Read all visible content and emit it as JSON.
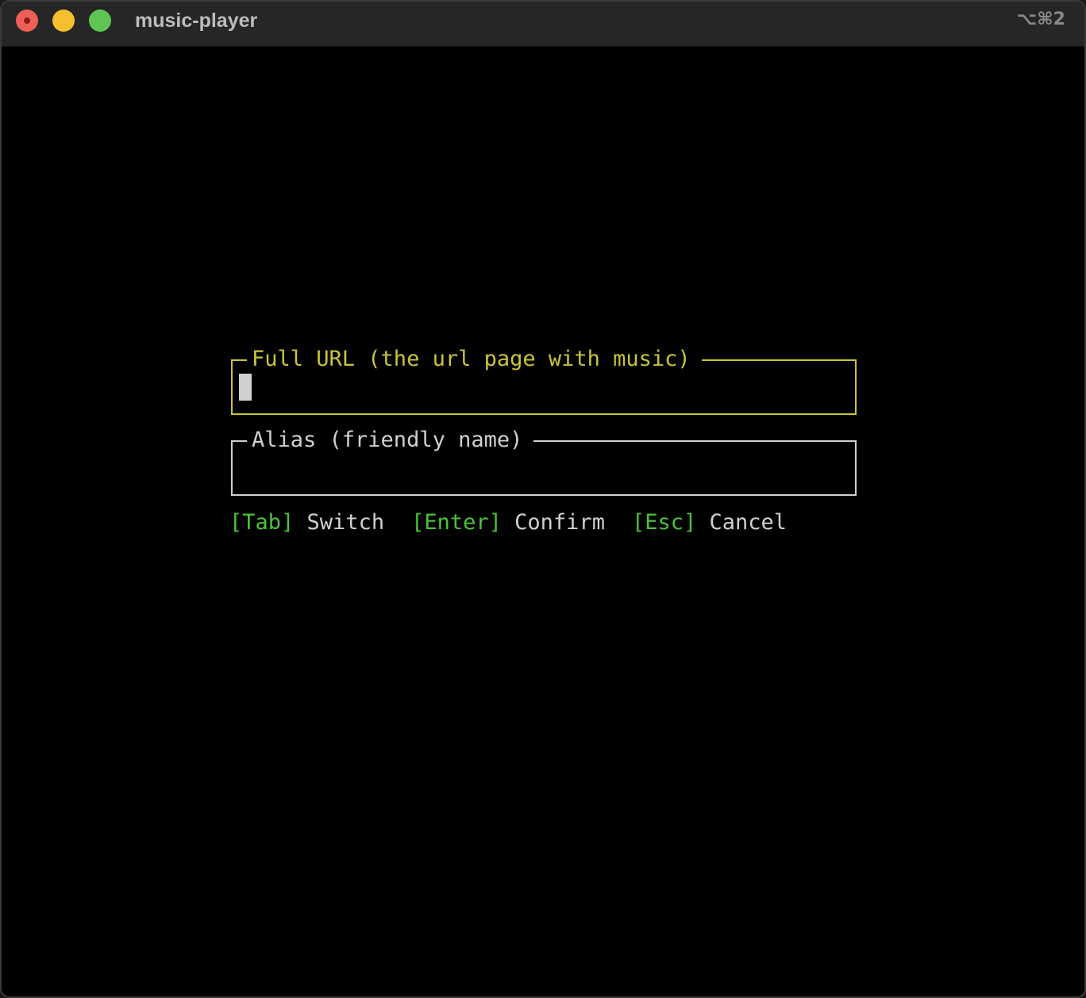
{
  "window": {
    "title": "music-player",
    "shortcut": "⌥⌘2"
  },
  "dialog": {
    "url_field": {
      "label": "Full URL (the url page with music)",
      "value": "",
      "focused": true
    },
    "alias_field": {
      "label": "Alias (friendly name)",
      "value": ""
    },
    "hints": [
      {
        "key": "[Tab]",
        "action": "Switch"
      },
      {
        "key": "[Enter]",
        "action": "Confirm"
      },
      {
        "key": "[Esc]",
        "action": "Cancel"
      }
    ]
  },
  "colors": {
    "focused_border": "#c9c43a",
    "normal_border": "#d0d0d0",
    "key_hint": "#4cc23a",
    "background": "#000000"
  }
}
